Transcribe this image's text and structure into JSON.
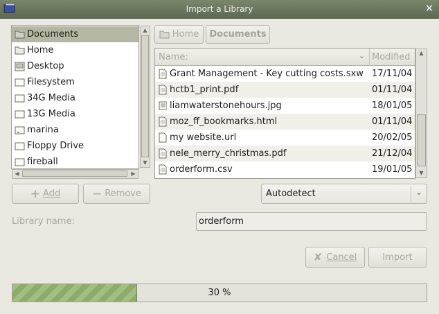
{
  "window": {
    "title": "Import a Library"
  },
  "places": {
    "items": [
      {
        "label": "Documents",
        "icon": "folder-icon",
        "selected": true
      },
      {
        "label": "Home",
        "icon": "folder-icon",
        "selected": false
      },
      {
        "label": "Desktop",
        "icon": "desktop-icon",
        "selected": false
      },
      {
        "label": "Filesystem",
        "icon": "drive-icon",
        "selected": false
      },
      {
        "label": "34G Media",
        "icon": "drive-icon",
        "selected": false
      },
      {
        "label": "13G Media",
        "icon": "drive-icon",
        "selected": false
      },
      {
        "label": "marina",
        "icon": "drive-icon",
        "selected": false
      },
      {
        "label": "Floppy Drive",
        "icon": "drive-icon",
        "selected": false
      },
      {
        "label": "fireball",
        "icon": "drive-icon",
        "selected": false
      }
    ],
    "add_label": "Add",
    "remove_label": "Remove"
  },
  "path_bar": {
    "home_label": "Home",
    "documents_label": "Documents"
  },
  "file_list": {
    "col_name": "Name:",
    "col_modified": "Modified",
    "rows": [
      {
        "name": "Grant Management - Key cutting costs.sxw",
        "modified": "17/11/04"
      },
      {
        "name": "hctb1_print.pdf",
        "modified": "01/11/04"
      },
      {
        "name": "liamwaterstonehours.jpg",
        "modified": "18/01/05"
      },
      {
        "name": "moz_ff_bookmarks.html",
        "modified": "01/11/04"
      },
      {
        "name": "my website.url",
        "modified": "20/02/05"
      },
      {
        "name": "nele_merry_christmas.pdf",
        "modified": "21/12/04"
      },
      {
        "name": "orderform.csv",
        "modified": "19/01/05"
      }
    ]
  },
  "format_combo": {
    "value": "Autodetect"
  },
  "library": {
    "label": "Library name:",
    "value": "orderform"
  },
  "actions": {
    "cancel_label": "Cancel",
    "import_label": "Import"
  },
  "progress": {
    "fraction": 0.3,
    "text": "30 %"
  },
  "colors": {
    "titlebar": "#6e7a60",
    "selection": "#b4b7a3",
    "progress": "#9cb87a"
  }
}
